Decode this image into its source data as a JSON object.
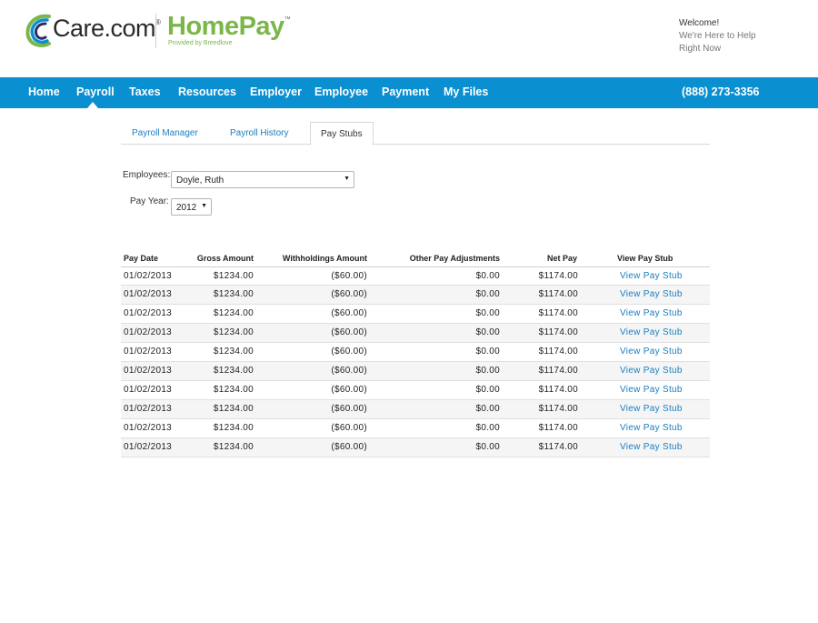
{
  "header": {
    "brand_name": "Care.com",
    "brand_mark": "®",
    "product_name": "HomePay",
    "product_mark": "™",
    "provided_by": "Provided by Breedlove",
    "welcome_line1": "Welcome!",
    "welcome_line2": "We're Here to Help",
    "welcome_line3": "Right Now"
  },
  "nav": {
    "items": [
      {
        "label": "Home"
      },
      {
        "label": "Payroll"
      },
      {
        "label": "Taxes"
      },
      {
        "label": "Resources"
      },
      {
        "label": "Employer"
      },
      {
        "label": "Employee"
      },
      {
        "label": "Payment"
      },
      {
        "label": "My Files"
      }
    ],
    "active": "Payroll",
    "phone": "(888) 273-3356"
  },
  "tabs": {
    "items": [
      {
        "label": "Payroll Manager"
      },
      {
        "label": "Payroll History"
      },
      {
        "label": "Pay Stubs"
      }
    ],
    "active": "Pay Stubs"
  },
  "form": {
    "employees_label": "Employees:",
    "employees_value": "Doyle, Ruth",
    "pay_year_label": "Pay Year:",
    "pay_year_value": "2012"
  },
  "table": {
    "headers": {
      "pay_date": "Pay Date",
      "gross": "Gross Amount",
      "withholdings": "Withholdings Amount",
      "adjustments": "Other Pay Adjustments",
      "net": "Net Pay",
      "stub": "View Pay Stub"
    },
    "rows": [
      {
        "pay_date": "01/02/2013",
        "gross": "$1234.00",
        "withholdings": "($60.00)",
        "adjustments": "$0.00",
        "net": "$1174.00",
        "stub": "View Pay Stub"
      },
      {
        "pay_date": "01/02/2013",
        "gross": "$1234.00",
        "withholdings": "($60.00)",
        "adjustments": "$0.00",
        "net": "$1174.00",
        "stub": "View Pay Stub"
      },
      {
        "pay_date": "01/02/2013",
        "gross": "$1234.00",
        "withholdings": "($60.00)",
        "adjustments": "$0.00",
        "net": "$1174.00",
        "stub": "View Pay Stub"
      },
      {
        "pay_date": "01/02/2013",
        "gross": "$1234.00",
        "withholdings": "($60.00)",
        "adjustments": "$0.00",
        "net": "$1174.00",
        "stub": "View Pay Stub"
      },
      {
        "pay_date": "01/02/2013",
        "gross": "$1234.00",
        "withholdings": "($60.00)",
        "adjustments": "$0.00",
        "net": "$1174.00",
        "stub": "View Pay Stub"
      },
      {
        "pay_date": "01/02/2013",
        "gross": "$1234.00",
        "withholdings": "($60.00)",
        "adjustments": "$0.00",
        "net": "$1174.00",
        "stub": "View Pay Stub"
      },
      {
        "pay_date": "01/02/2013",
        "gross": "$1234.00",
        "withholdings": "($60.00)",
        "adjustments": "$0.00",
        "net": "$1174.00",
        "stub": "View Pay Stub"
      },
      {
        "pay_date": "01/02/2013",
        "gross": "$1234.00",
        "withholdings": "($60.00)",
        "adjustments": "$0.00",
        "net": "$1174.00",
        "stub": "View Pay Stub"
      },
      {
        "pay_date": "01/02/2013",
        "gross": "$1234.00",
        "withholdings": "($60.00)",
        "adjustments": "$0.00",
        "net": "$1174.00",
        "stub": "View Pay Stub"
      },
      {
        "pay_date": "01/02/2013",
        "gross": "$1234.00",
        "withholdings": "($60.00)",
        "adjustments": "$0.00",
        "net": "$1174.00",
        "stub": "View Pay Stub"
      }
    ]
  },
  "colors": {
    "nav_bg": "#0a8fd0",
    "link": "#1a7dbf",
    "homepay_green": "#7ab648"
  }
}
